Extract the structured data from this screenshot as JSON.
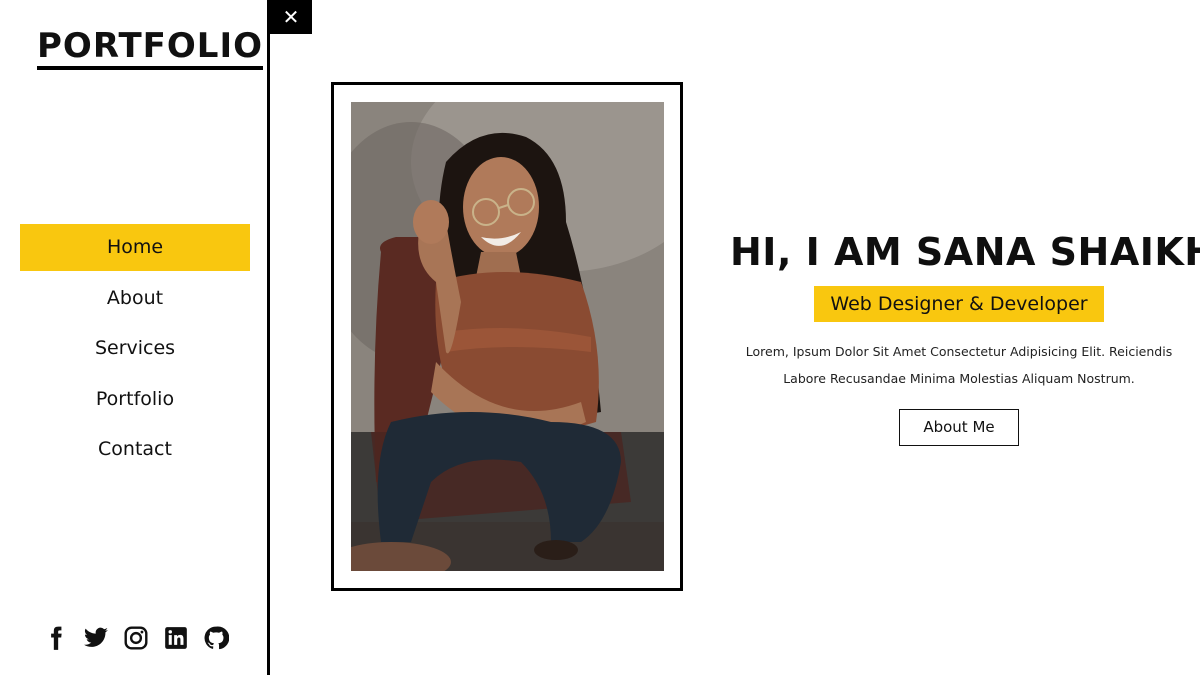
{
  "logo": {
    "text": "PORTFOLIO"
  },
  "nav": {
    "items": [
      {
        "label": "Home",
        "active": true
      },
      {
        "label": "About",
        "active": false
      },
      {
        "label": "Services",
        "active": false
      },
      {
        "label": "Portfolio",
        "active": false
      },
      {
        "label": "Contact",
        "active": false
      }
    ]
  },
  "socials": [
    "facebook-icon",
    "twitter-icon",
    "instagram-icon",
    "linkedin-icon",
    "github-icon"
  ],
  "close_button": {
    "glyph": "✕"
  },
  "hero": {
    "title": "HI, I AM SANA SHAIKH",
    "role": "Web Designer & Developer",
    "description_line1": "Lorem, Ipsum Dolor Sit Amet Consectetur Adipisicing Elit. Reiciendis",
    "description_line2": "Labore Recusandae Minima Molestias Aliquam Nostrum.",
    "button_label": "About Me"
  },
  "colors": {
    "accent": "#f9c70f",
    "text": "#111111",
    "border": "#000000",
    "background": "#ffffff"
  }
}
